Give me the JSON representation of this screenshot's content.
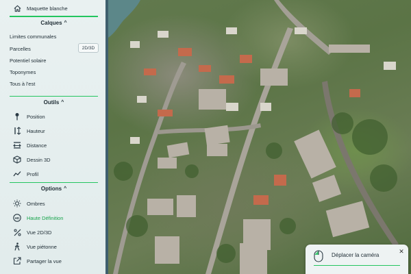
{
  "home": {
    "label": "Maquette blanche",
    "icon": "home-icon"
  },
  "sections": {
    "calques": {
      "title": "Calques",
      "chevron": "^"
    },
    "outils": {
      "title": "Outils",
      "chevron": "^"
    },
    "options": {
      "title": "Options",
      "chevron": "^"
    }
  },
  "layers": [
    {
      "label": "Limites communales"
    },
    {
      "label": "Parcelles",
      "badge": "2D/3D"
    },
    {
      "label": "Potentiel solaire"
    },
    {
      "label": "Toponymes"
    },
    {
      "label": "Tous à l'est"
    }
  ],
  "tools": [
    {
      "label": "Position",
      "icon": "pin-icon"
    },
    {
      "label": "Hauteur",
      "icon": "height-icon"
    },
    {
      "label": "Distance",
      "icon": "distance-icon"
    },
    {
      "label": "Dessin 3D",
      "icon": "cube-icon"
    },
    {
      "label": "Profil",
      "icon": "profile-chart-icon"
    }
  ],
  "options": [
    {
      "label": "Ombres",
      "icon": "sun-icon",
      "active": false
    },
    {
      "label": "Haute Définition",
      "icon": "hd-icon",
      "active": true
    },
    {
      "label": "Vue 2D/3D",
      "icon": "percent-icon",
      "active": false
    },
    {
      "label": "Vue piétonne",
      "icon": "pedestrian-icon",
      "active": false
    },
    {
      "label": "Partager la vue",
      "icon": "share-icon",
      "active": false
    }
  ],
  "camera_panel": {
    "label": "Déplacer la caméra",
    "icon": "mouse-icon",
    "close": "✕"
  },
  "colors": {
    "accent": "#22c55e",
    "active": "#16a34a",
    "sidebar_bg": "#e6eeee",
    "sidebar_border": "#3f5f6e"
  }
}
